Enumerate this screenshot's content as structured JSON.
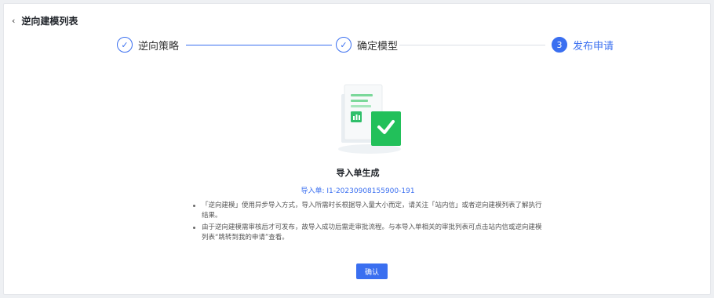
{
  "header": {
    "back_icon": "chevron-left-icon",
    "title": "逆向建模列表"
  },
  "steps": [
    {
      "label": "逆向策略",
      "status": "done",
      "marker": "✓"
    },
    {
      "label": "确定模型",
      "status": "done",
      "marker": "✓"
    },
    {
      "label": "发布申请",
      "status": "active",
      "marker": "3"
    }
  ],
  "result": {
    "title": "导入单生成",
    "order_text": "导入单: I1-20230908155900-191"
  },
  "notes": [
    "「逆向建模」使用异步导入方式，导入所需时长根据导入量大小而定，请关注「站内信」或者逆向建模列表了解执行结果。",
    "由于逆向建模需审核后才可发布，故导入成功后需走审批流程。与本导入单相关的审批列表可点击站内信或逆向建模列表“跳转到我的申请”查看。"
  ],
  "confirm_label": "确认",
  "colors": {
    "accent": "#3a6ff0",
    "success": "#22c05a"
  }
}
